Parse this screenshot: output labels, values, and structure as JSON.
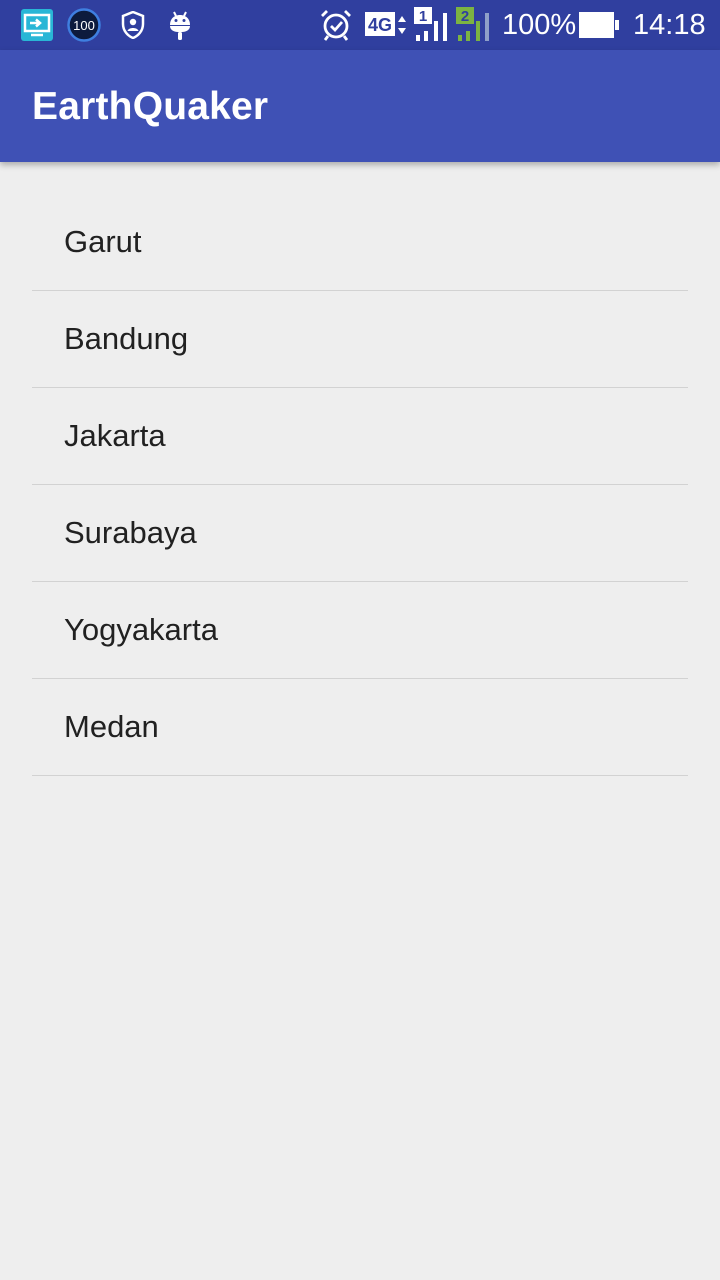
{
  "status_bar": {
    "notification_icons": [
      "screen-share-icon",
      "cleaner-100-icon",
      "shield-user-icon",
      "android-icon"
    ],
    "cleaner_badge": "100",
    "network_type": "4G",
    "sim1_label": "1",
    "sim2_label": "2",
    "battery_percent": "100%",
    "battery_level": 1.0,
    "time": "14:18"
  },
  "app_bar": {
    "title": "EarthQuaker"
  },
  "list": {
    "items": [
      {
        "label": "Garut"
      },
      {
        "label": "Bandung"
      },
      {
        "label": "Jakarta"
      },
      {
        "label": "Surabaya"
      },
      {
        "label": "Yogyakarta"
      },
      {
        "label": "Medan"
      }
    ]
  },
  "colors": {
    "status_bar": "#303f9f",
    "app_bar": "#3f51b5",
    "background": "#eeeeee",
    "sim2_signal": "#7cb342"
  }
}
